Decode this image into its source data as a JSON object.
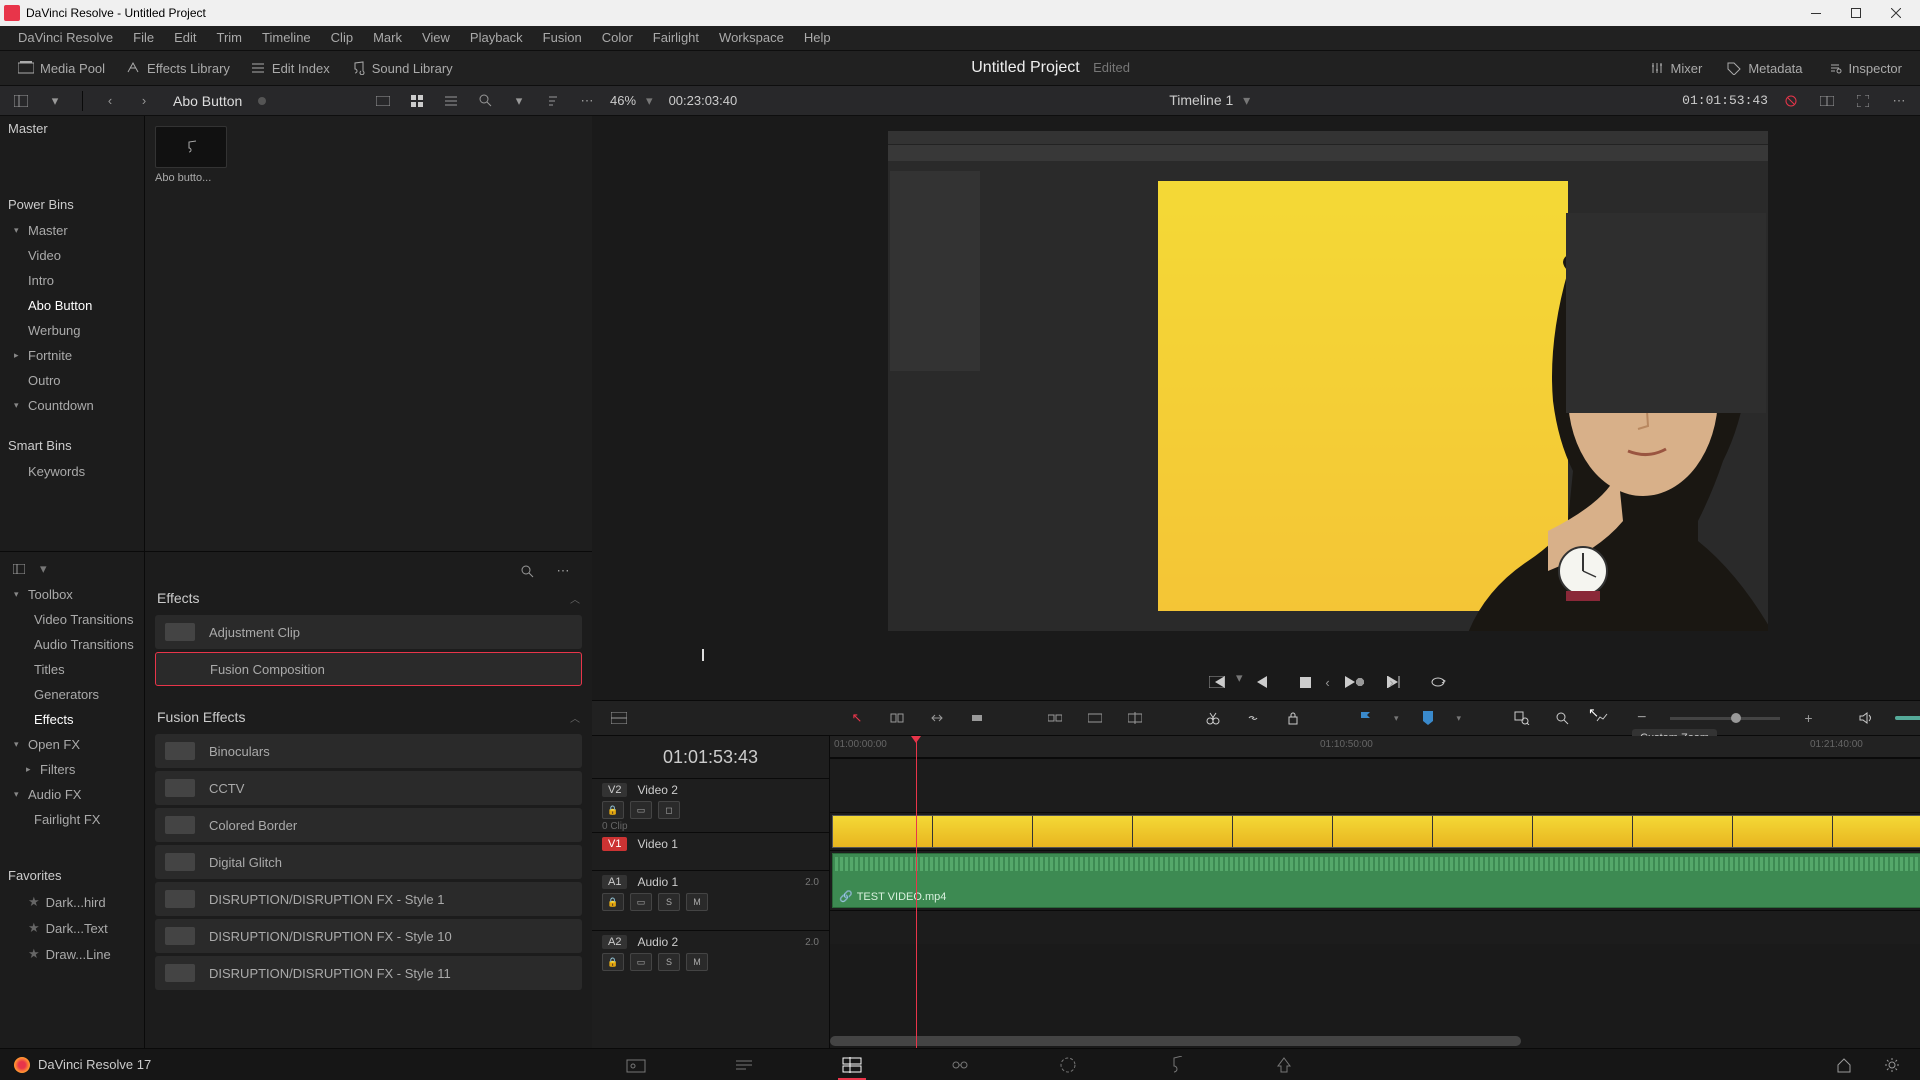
{
  "window": {
    "title": "DaVinci Resolve - Untitled Project"
  },
  "menu": [
    "DaVinci Resolve",
    "File",
    "Edit",
    "Trim",
    "Timeline",
    "Clip",
    "Mark",
    "View",
    "Playback",
    "Fusion",
    "Color",
    "Fairlight",
    "Workspace",
    "Help"
  ],
  "toptoolbar": {
    "media_pool": "Media Pool",
    "effects_lib": "Effects Library",
    "edit_index": "Edit Index",
    "sound_lib": "Sound Library",
    "project_title": "Untitled Project",
    "edited": "Edited",
    "mixer": "Mixer",
    "metadata": "Metadata",
    "inspector": "Inspector"
  },
  "subtoolbar": {
    "bin_label": "Abo Button",
    "zoom": "46%",
    "duration": "00:23:03:40",
    "timeline_name": "Timeline 1",
    "tc_right": "01:01:53:43"
  },
  "bins": {
    "master": "Master",
    "power": "Power Bins",
    "smart": "Smart Bins",
    "items": [
      "Master",
      "Video",
      "Intro",
      "Abo Button",
      "Werbung",
      "Fortnite",
      "Outro",
      "Countdown"
    ],
    "keywords": "Keywords"
  },
  "clip": {
    "name": "Abo butto..."
  },
  "eff_tree": {
    "toolbox": "Toolbox",
    "items": [
      "Video Transitions",
      "Audio Transitions",
      "Titles",
      "Generators",
      "Effects"
    ],
    "openfx": "Open FX",
    "filters": "Filters",
    "audiofx": "Audio FX",
    "fairlight": "Fairlight FX",
    "favorites": "Favorites",
    "favs": [
      "Dark...hird",
      "Dark...Text",
      "Draw...Line"
    ]
  },
  "effects": {
    "section1": "Effects",
    "adj": "Adjustment Clip",
    "fusion_comp": "Fusion Composition",
    "section2": "Fusion Effects",
    "list": [
      "Binoculars",
      "CCTV",
      "Colored Border",
      "Digital Glitch",
      "DISRUPTION/DISRUPTION FX - Style 1",
      "DISRUPTION/DISRUPTION FX - Style 10",
      "DISRUPTION/DISRUPTION FX - Style 11"
    ]
  },
  "timeline": {
    "tc": "01:01:53:43",
    "v2": {
      "badge": "V2",
      "name": "Video 2",
      "clips": "0 Clip"
    },
    "v1": {
      "badge": "V1",
      "name": "Video 1"
    },
    "a1": {
      "badge": "A1",
      "name": "Audio 1",
      "ch": "2.0",
      "clip_label": "TEST VIDEO.mp4"
    },
    "a2": {
      "badge": "A2",
      "name": "Audio 2",
      "ch": "2.0"
    },
    "ruler": [
      "01:00:00:00",
      "01:10:50:00",
      "01:21:40:00"
    ]
  },
  "tooltip": "Custom Zoom",
  "pagebar": {
    "label": "DaVinci Resolve 17"
  }
}
